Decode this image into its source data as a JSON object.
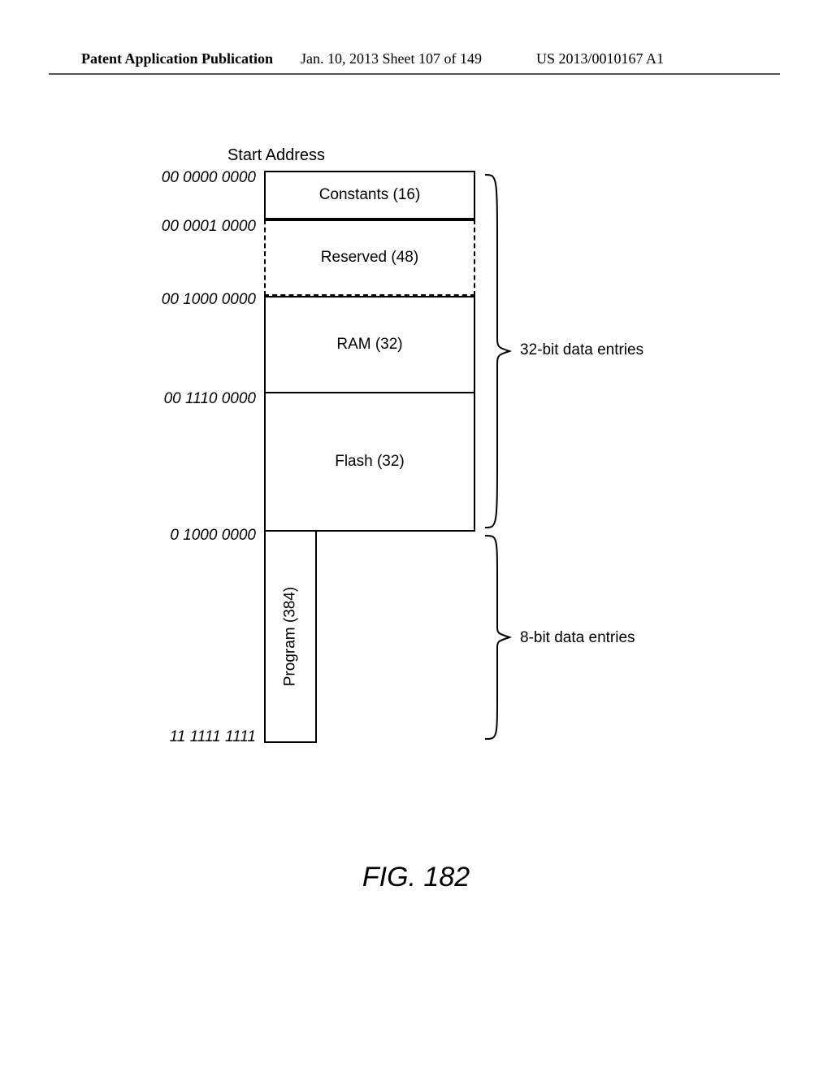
{
  "header": {
    "left": "Patent Application Publication",
    "center": "Jan. 10, 2013  Sheet 107 of 149",
    "right": "US 2013/0010167 A1"
  },
  "title": "Start Address",
  "addresses": {
    "a0": "00 0000 0000",
    "a1": "00 0001 0000",
    "a2": "00 1000 0000",
    "a3": "00 1110 0000",
    "a4": "0 1000 0000",
    "a5": "11 1111 1111"
  },
  "boxes": {
    "constants": "Constants (16)",
    "reserved": "Reserved (48)",
    "ram": "RAM (32)",
    "flash": "Flash (32)",
    "program": "Program (384)"
  },
  "braces": {
    "upper": "32-bit data entries",
    "lower": "8-bit data entries"
  },
  "figure": "FIG. 182",
  "chart_data": {
    "type": "table",
    "title": "Memory Map",
    "regions": [
      {
        "start_address": "00 0000 0000",
        "name": "Constants",
        "entries": 16,
        "width_bits": 32
      },
      {
        "start_address": "00 0001 0000",
        "name": "Reserved",
        "entries": 48,
        "width_bits": 32
      },
      {
        "start_address": "00 1000 0000",
        "name": "RAM",
        "entries": 32,
        "width_bits": 32
      },
      {
        "start_address": "00 1110 0000",
        "name": "Flash",
        "entries": 32,
        "width_bits": 32
      },
      {
        "start_address": "0 1000 0000",
        "name": "Program",
        "entries": 384,
        "width_bits": 8
      }
    ],
    "end_address": "11 1111 1111"
  }
}
